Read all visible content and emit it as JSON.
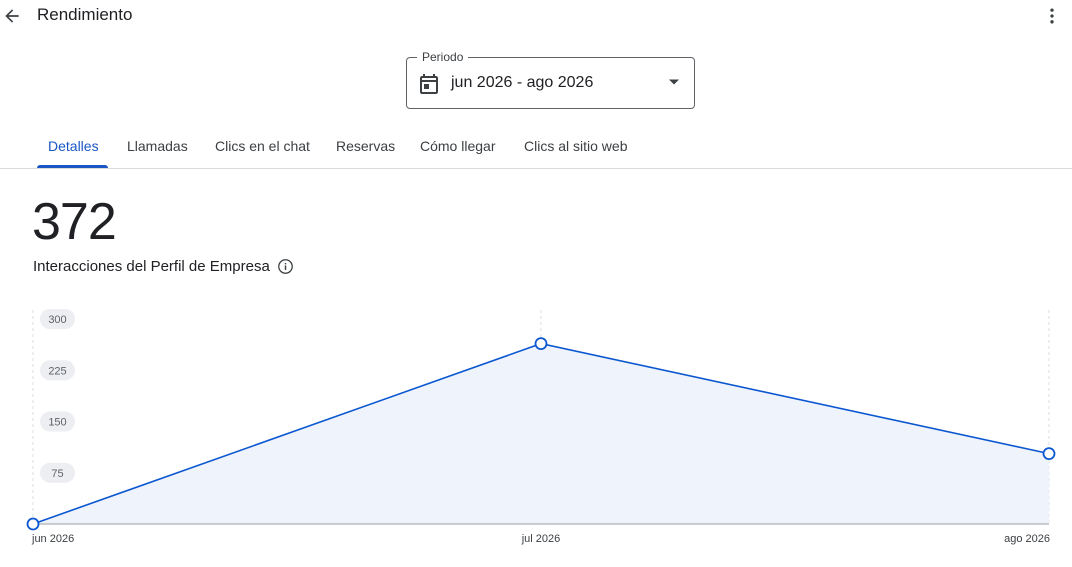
{
  "header": {
    "title": "Rendimiento",
    "back_icon": "arrow-back-icon",
    "more_icon": "more-vert-icon"
  },
  "period": {
    "label": "Periodo",
    "value": "jun 2026 - ago 2026",
    "calendar_icon": "calendar-icon",
    "dropdown_icon": "arrow-drop-down-icon"
  },
  "tabs": [
    {
      "label": "Detalles",
      "active": true
    },
    {
      "label": "Llamadas",
      "active": false
    },
    {
      "label": "Clics en el chat",
      "active": false
    },
    {
      "label": "Reservas",
      "active": false
    },
    {
      "label": "Cómo llegar",
      "active": false
    },
    {
      "label": "Clics al sitio web",
      "active": false
    }
  ],
  "metric": {
    "value": "372",
    "label": "Interacciones del Perfil de Empresa",
    "info_icon": "info-icon"
  },
  "colors": {
    "accent": "#1a56c4",
    "line": "#0b57d0",
    "area_fill": "#eef3fc",
    "text": "#202124",
    "muted": "#5f6368"
  },
  "chart_data": {
    "type": "line",
    "categories": [
      "jun 2026",
      "jul 2026",
      "ago 2026"
    ],
    "values": [
      0,
      264,
      103
    ],
    "ylim": [
      0,
      300
    ],
    "yticks": [
      75,
      150,
      225,
      300
    ],
    "grid": "vertical-dashed",
    "area_fill": true
  }
}
